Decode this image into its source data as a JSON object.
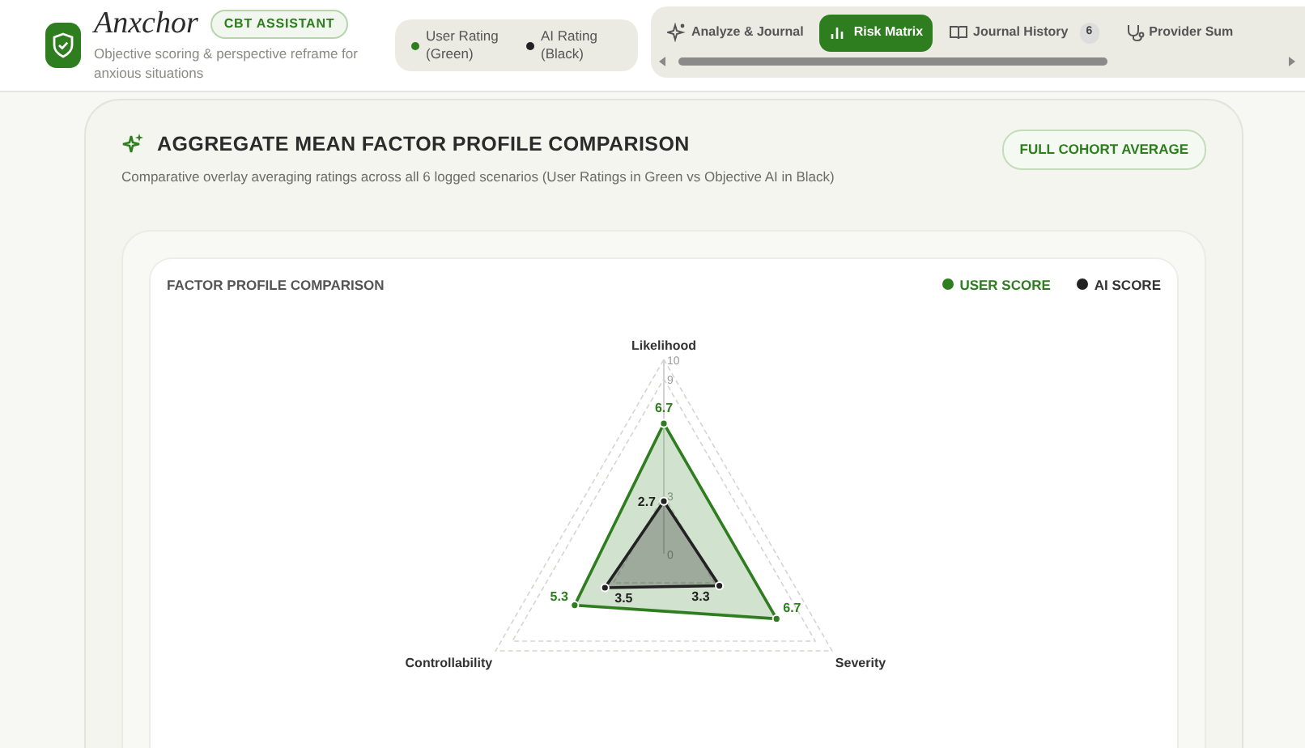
{
  "brand": {
    "name": "Anxchor",
    "badge": "CBT ASSISTANT",
    "tagline": "Objective scoring & perspective reframe for anxious situations"
  },
  "rating_legend": [
    {
      "label": "User Rating (Green)",
      "color": "#2e7d1f"
    },
    {
      "label": "AI Rating (Black)",
      "color": "#222222"
    }
  ],
  "tabs": [
    {
      "label": "Analyze & Journal",
      "selected": false
    },
    {
      "label": "Risk Matrix",
      "selected": true
    },
    {
      "label": "Journal History",
      "selected": false,
      "count": "6"
    },
    {
      "label": "Provider Sum",
      "selected": false
    }
  ],
  "panel": {
    "title": "AGGREGATE MEAN FACTOR PROFILE COMPARISON",
    "subtitle": "Comparative overlay averaging ratings across all 6 logged scenarios (User Ratings in Green vs Objective AI in Black)",
    "scope_badge": "FULL COHORT AVERAGE",
    "chart_card": {
      "title": "FACTOR PROFILE COMPARISON",
      "radar": {
        "kind": "filled",
        "axes": [
          "Likelihood",
          "Severity",
          "Controllability"
        ],
        "series": [
          {
            "name": "USER SCORE",
            "color": "#2e7d1f",
            "values": [
              "6.7",
              "6.7",
              "5.3"
            ]
          },
          {
            "name": "AI SCORE",
            "color": "#222222",
            "values": [
              "2.7",
              "3.3",
              "3.5"
            ]
          }
        ],
        "scale_labels": [
          "10",
          "9",
          "3",
          "0"
        ]
      }
    }
  }
}
